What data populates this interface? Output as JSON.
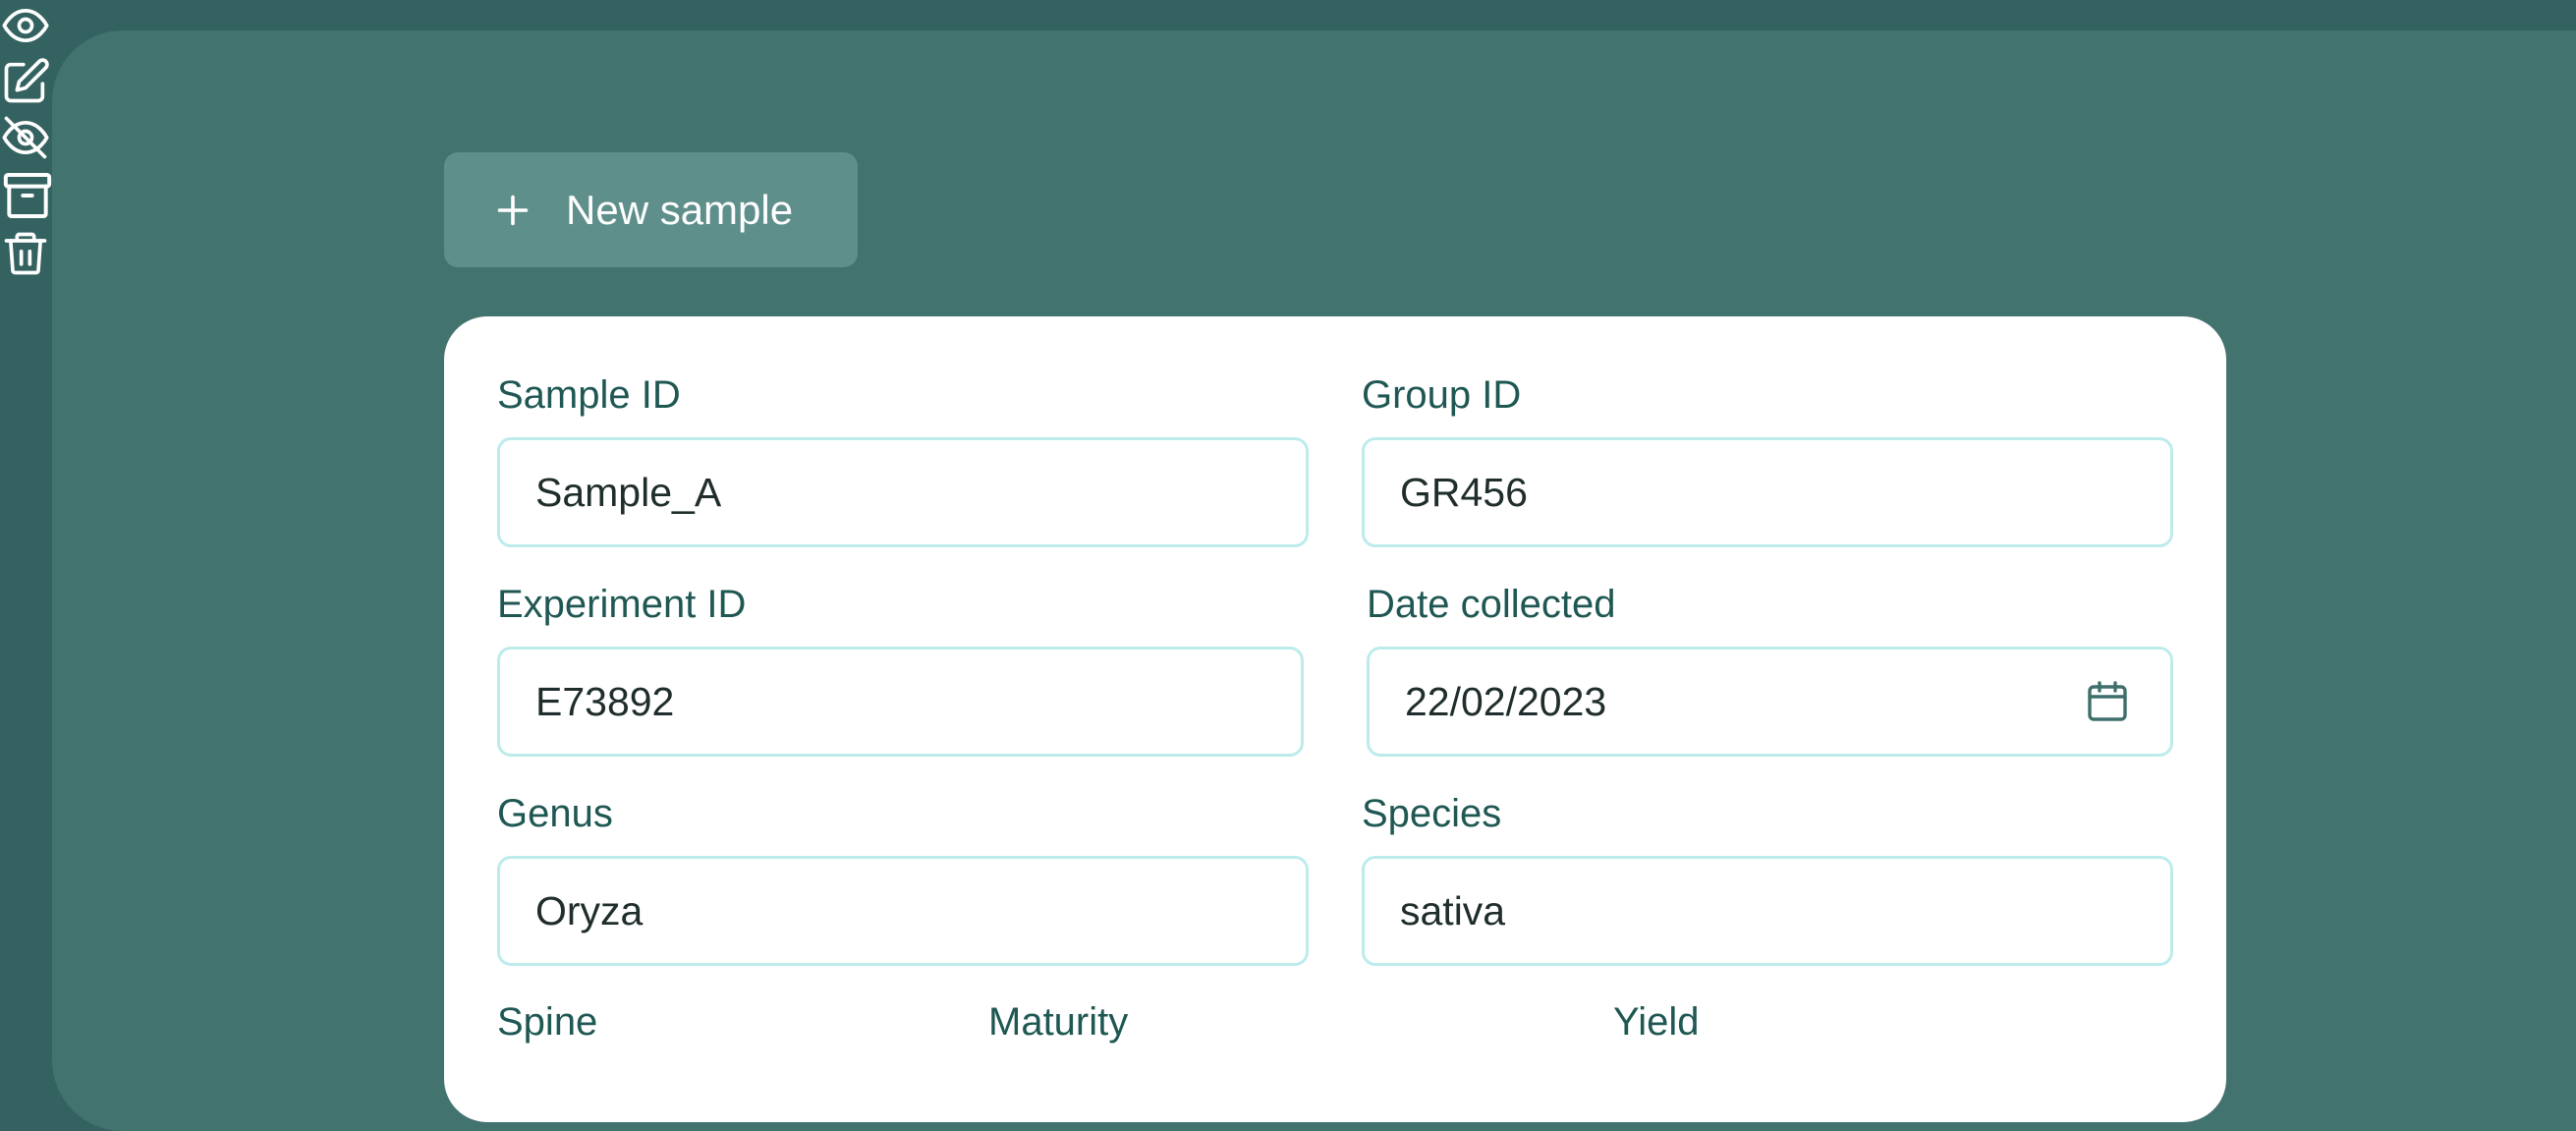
{
  "toolbar": {
    "new_sample_label": "New sample",
    "icons": [
      "eye-icon",
      "edit-icon",
      "eye-off-icon",
      "archive-icon",
      "trash-icon"
    ]
  },
  "form": {
    "sample_id": {
      "label": "Sample ID",
      "value": "Sample_A"
    },
    "group_id": {
      "label": "Group ID",
      "value": "GR456"
    },
    "experiment_id": {
      "label": "Experiment ID",
      "value": "E73892"
    },
    "date_collected": {
      "label": "Date collected",
      "value": "22/02/2023"
    },
    "genus": {
      "label": "Genus",
      "value": "Oryza"
    },
    "species": {
      "label": "Species",
      "value": "sativa"
    },
    "spine": {
      "label": "Spine"
    },
    "maturity": {
      "label": "Maturity"
    },
    "yield": {
      "label": "Yield"
    }
  },
  "colors": {
    "background": "#346260",
    "panel": "#42736f",
    "button": "#5f8f8b",
    "label": "#1f5753",
    "input_border": "#bdebec"
  }
}
